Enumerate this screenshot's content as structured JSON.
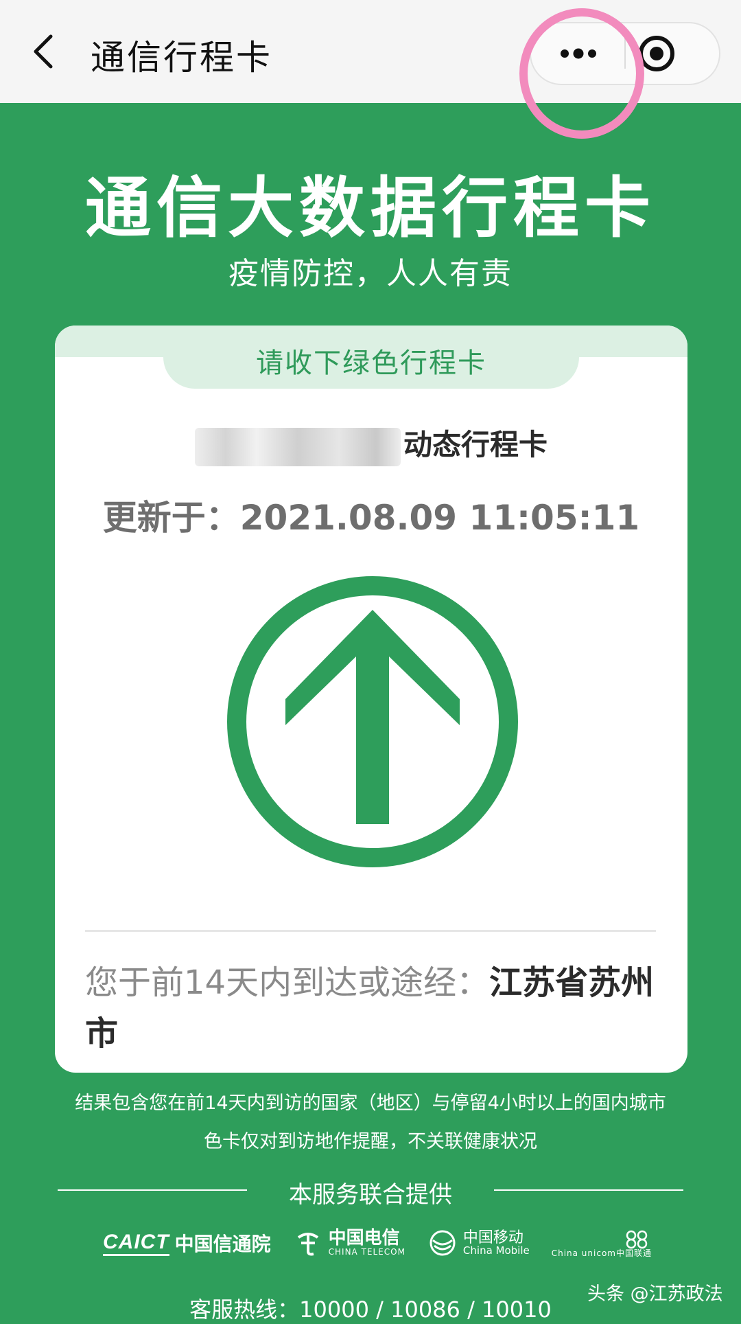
{
  "nav": {
    "title": "通信行程卡",
    "back_icon": "chevron-left-icon",
    "more_icon": "more-dots-icon",
    "close_icon": "target-circle-icon",
    "highlight_color": "#f28bbd"
  },
  "header": {
    "title": "通信大数据行程卡",
    "subtitle": "疫情防控，人人有责"
  },
  "card": {
    "tab_label": "请收下绿色行程卡",
    "owner_suffix": "动态行程卡",
    "update_time": "更新于：2021.08.09 11:05:11",
    "status_color": "#2e9e5b",
    "status_icon": "up-arrow-circle-icon",
    "visited_prefix": "您于前14天内到达或途经：",
    "visited_city": "江苏省苏州市"
  },
  "footer": {
    "note_line1": "结果包含您在前14天内到访的国家（地区）与停留4小时以上的国内城市",
    "note_line2": "色卡仅对到访地作提醒，不关联健康状况",
    "provider_label": "本服务联合提供",
    "logos": {
      "caict_mark": "CAICT",
      "caict_cn": "中国信通院",
      "telecom_cn": "中国电信",
      "telecom_en": "CHINA TELECOM",
      "mobile_cn": "中国移动",
      "mobile_en": "China Mobile",
      "unicom_en": "China unicom中国联通"
    },
    "hotline": "客服热线：10000 / 10086 / 10010",
    "watermark": "头条 @江苏政法"
  }
}
